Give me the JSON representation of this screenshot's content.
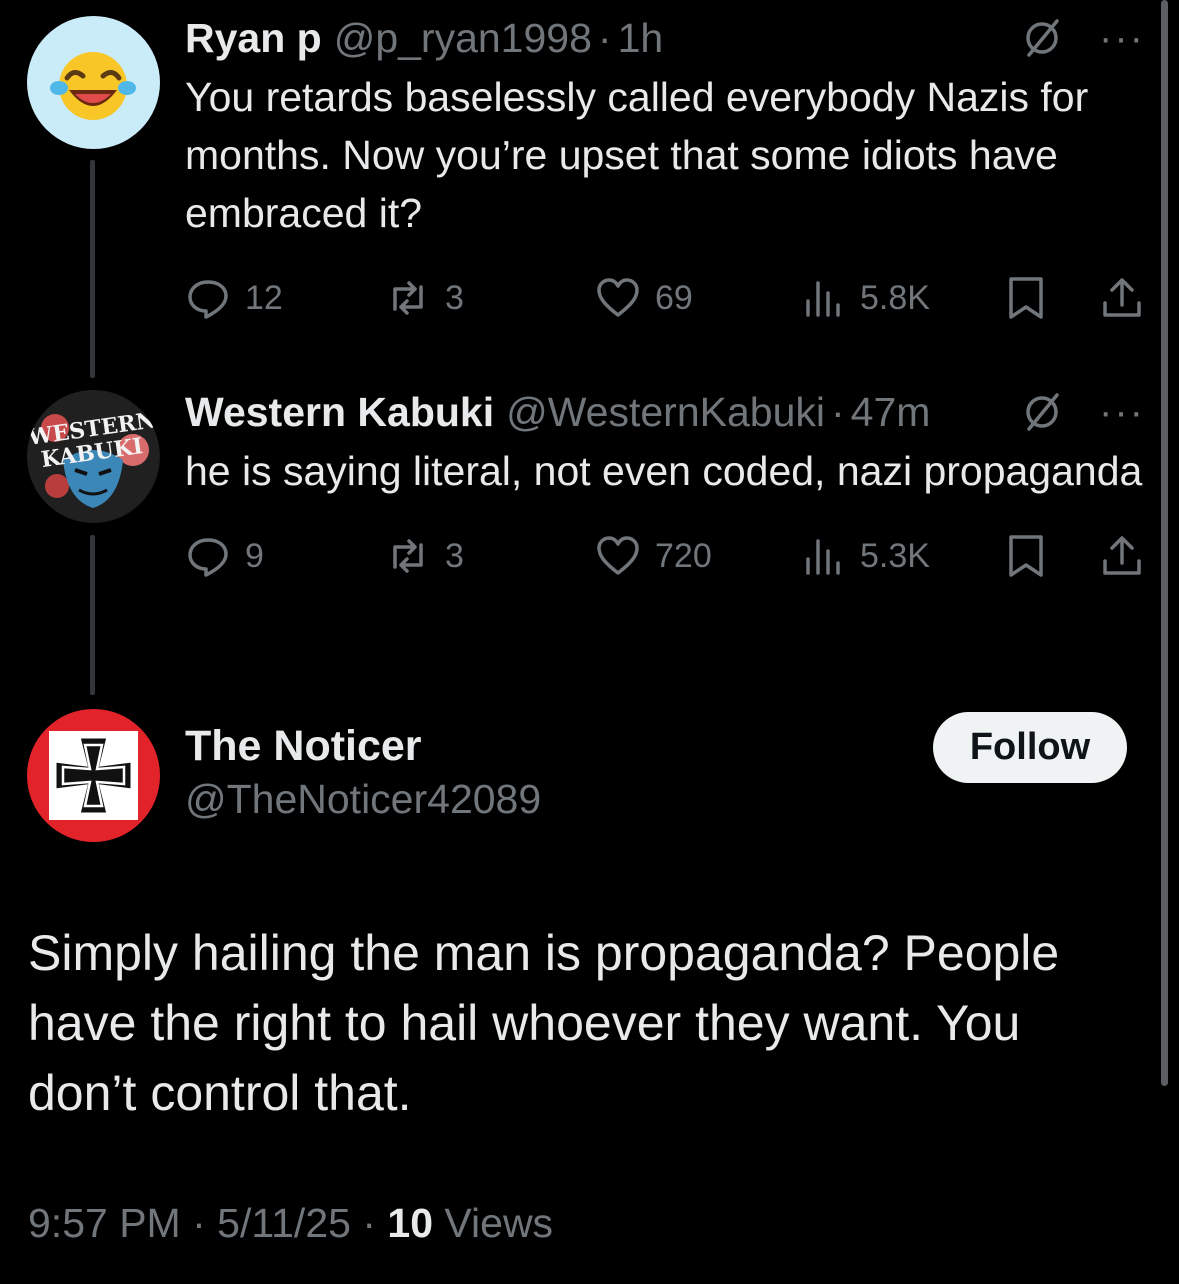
{
  "replies": [
    {
      "name": "Ryan p",
      "handle": "@p_ryan1998",
      "separator": "·",
      "time": "1h",
      "text": "You retards baselessly called everybody Nazis for months. Now you’re upset that some idiots have embraced it?",
      "stats": {
        "replies": "12",
        "reposts": "3",
        "likes": "69",
        "views": "5.8K"
      },
      "more": "···"
    },
    {
      "name": "Western Kabuki",
      "handle": "@WesternKabuki",
      "separator": "·",
      "time": "47m",
      "text": "he is saying literal, not even coded, nazi propaganda",
      "stats": {
        "replies": "9",
        "reposts": "3",
        "likes": "720",
        "views": "5.3K"
      },
      "more": "···",
      "avatar_lettering": [
        "WESTERN",
        "KABUKI"
      ]
    }
  ],
  "main_post": {
    "name": "The Noticer",
    "handle": "@TheNoticer42089",
    "follow_label": "Follow",
    "text": "Simply hailing the man is propaganda? People have the right to hail whoever they want. You don’t control that.",
    "time": "9:57 PM",
    "date": "5/11/25",
    "separator": "·",
    "views_count": "10",
    "views_label": "Views"
  },
  "colors": {
    "background": "#000000",
    "text": "#e7e9ea",
    "muted": "#71767b",
    "follow_bg": "#eff3f4",
    "avatar_red": "#e3232a"
  },
  "icons": [
    "laughing-emoji-icon",
    "no-image-icon",
    "reply-icon",
    "repost-icon",
    "like-icon",
    "views-icon",
    "bookmark-icon",
    "share-icon",
    "cross-icon"
  ]
}
